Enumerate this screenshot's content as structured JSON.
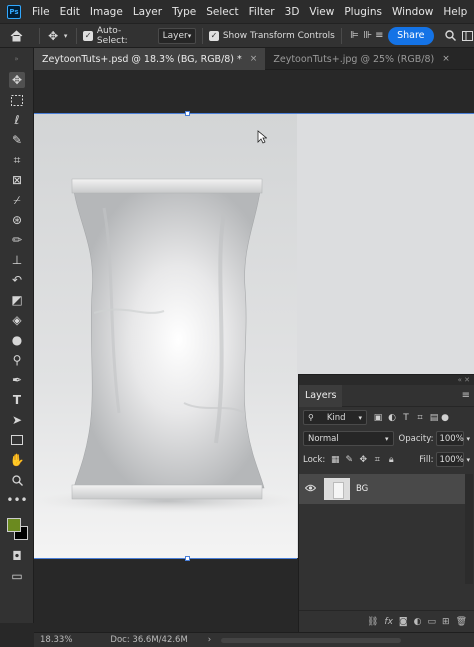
{
  "app": {
    "logo": "Ps"
  },
  "menu": [
    "File",
    "Edit",
    "Image",
    "Layer",
    "Type",
    "Select",
    "Filter",
    "3D",
    "View",
    "Plugins",
    "Window",
    "Help"
  ],
  "options": {
    "auto_select_label": "Auto-Select:",
    "auto_select_value": "Layer",
    "transform_label": "Show Transform Controls",
    "share_label": "Share"
  },
  "tabs": [
    {
      "label": "ZeytoonTuts+.psd @ 18.3% (BG, RGB/8) *",
      "close": "×"
    },
    {
      "label": "ZeytoonTuts+.jpg @ 25% (RGB/8)",
      "close": "×"
    }
  ],
  "colors": {
    "foreground": "#6b8a1f",
    "background": "#000000",
    "accent": "#1473e6"
  },
  "layers_panel": {
    "title": "Layers",
    "filter_kind": "Kind",
    "blend_mode": "Normal",
    "opacity_label": "Opacity:",
    "opacity_value": "100%",
    "lock_label": "Lock:",
    "fill_label": "Fill:",
    "fill_value": "100%",
    "layer_name": "BG"
  },
  "status": {
    "zoom": "18.33%",
    "doc": "Doc: 36.6M/42.6M"
  }
}
